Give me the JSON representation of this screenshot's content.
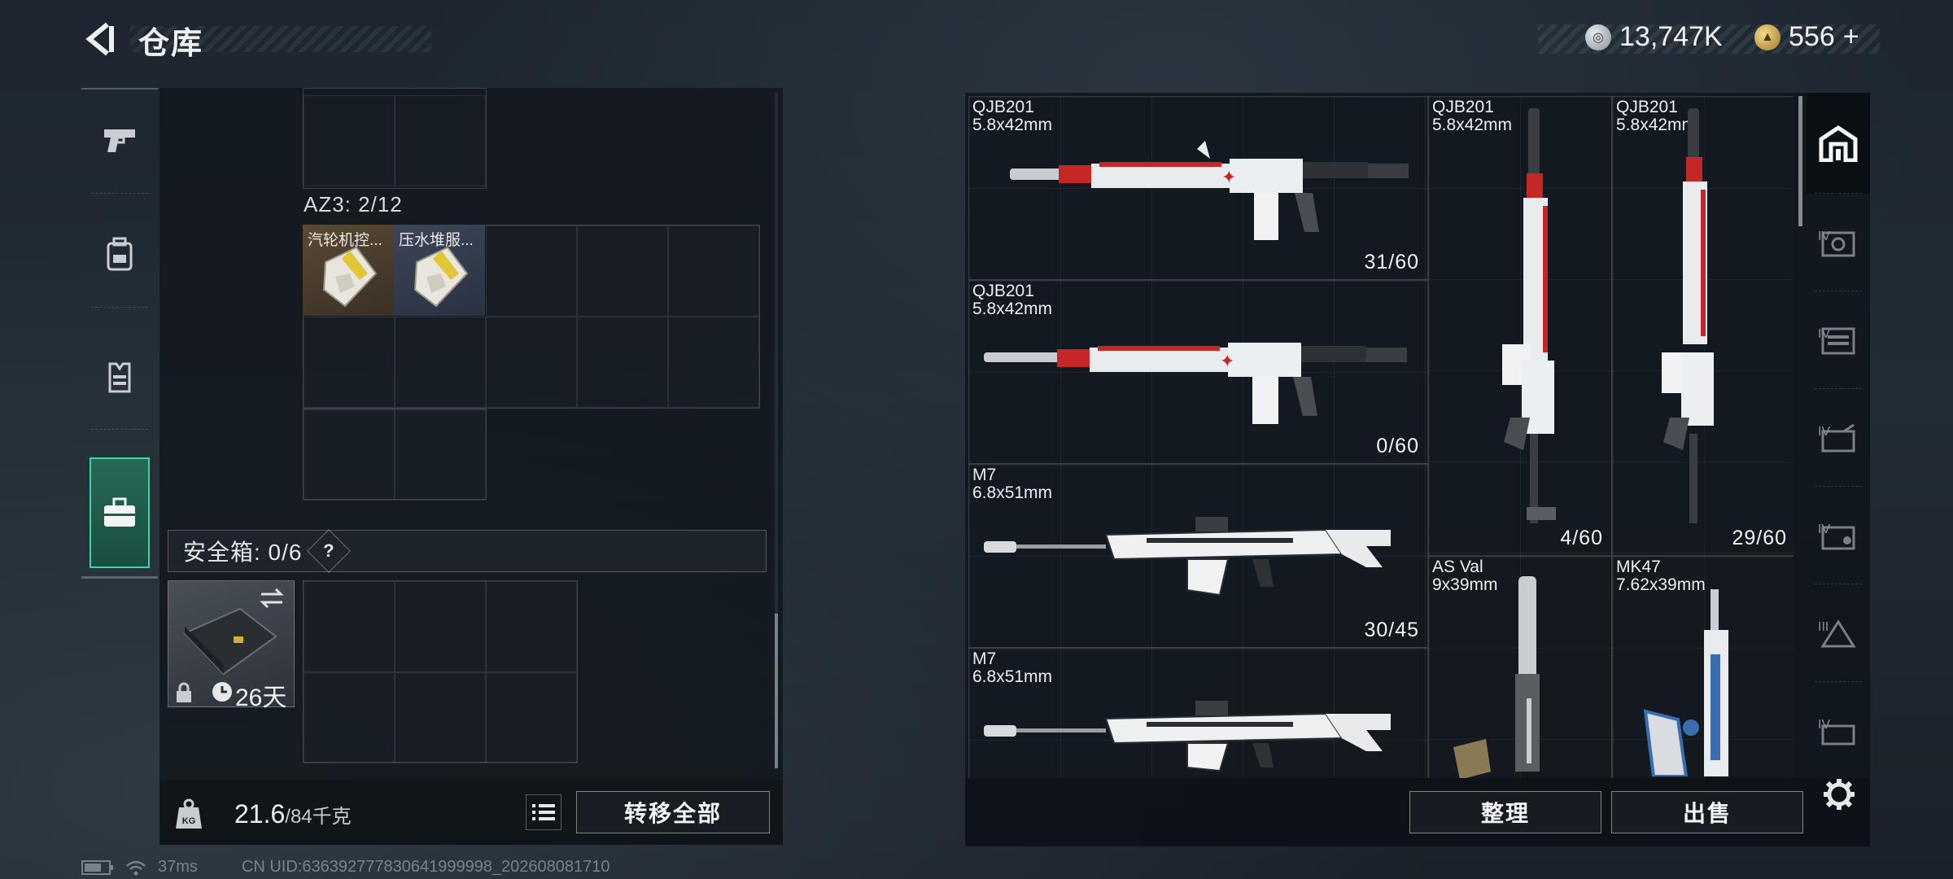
{
  "header": {
    "title": "仓库",
    "currency": [
      {
        "icon": "silver-coin-icon",
        "value": "13,747K"
      },
      {
        "icon": "gold-coin-icon",
        "value": "556"
      }
    ],
    "add_label": "+"
  },
  "left_rail": {
    "items": [
      {
        "icon": "pistol-icon",
        "active": false
      },
      {
        "icon": "backpack-icon",
        "active": false
      },
      {
        "icon": "vest-icon",
        "active": false
      },
      {
        "icon": "briefcase-icon",
        "active": true
      }
    ]
  },
  "inventory": {
    "az3_label": "AZ3: 2/12",
    "items": [
      {
        "name": "汽轮机控...",
        "icon": "supply-pack-icon"
      },
      {
        "name": "压水堆服...",
        "icon": "supply-pack-icon"
      }
    ],
    "safe_box": {
      "label": "安全箱: 0/6",
      "help": "?",
      "days": "26天",
      "swap_icon": "swap-arrows-icon",
      "lock_icon": "lock-icon",
      "clock_icon": "clock-icon"
    }
  },
  "left_footer": {
    "kg_label": "KG",
    "weight_current": "21.6",
    "weight_max": "/84千克",
    "transfer_all": "转移全部"
  },
  "weapons": [
    {
      "name": "QJB201",
      "caliber": "5.8x42mm",
      "ammo": "31/60"
    },
    {
      "name": "QJB201",
      "caliber": "5.8x42mm",
      "ammo": "0/60"
    },
    {
      "name": "M7",
      "caliber": "6.8x51mm",
      "ammo": "30/45"
    },
    {
      "name": "M7",
      "caliber": "6.8x51mm",
      "ammo": ""
    },
    {
      "name": "QJB201",
      "caliber": "5.8x42mm",
      "ammo": "4/60"
    },
    {
      "name": "QJB201",
      "caliber": "5.8x42mm",
      "ammo": "29/60"
    },
    {
      "name": "AS Val",
      "caliber": "9x39mm",
      "ammo": ""
    },
    {
      "name": "MK47",
      "caliber": "7.62x39mm",
      "ammo": ""
    }
  ],
  "right_footer": {
    "sort": "整理",
    "sell": "出售"
  },
  "side_rail": {
    "items": [
      {
        "icon": "warehouse-icon",
        "level": "",
        "active": true
      },
      {
        "icon": "storage-crate-icon",
        "level": "IV",
        "active": false
      },
      {
        "icon": "cabinet-icon",
        "level": "IV",
        "active": false
      },
      {
        "icon": "ammo-box-icon",
        "level": "IV",
        "active": false
      },
      {
        "icon": "case-icon",
        "level": "IV",
        "active": false
      },
      {
        "icon": "supply-box-icon",
        "level": "III",
        "active": false
      },
      {
        "icon": "container-icon",
        "level": "IV",
        "active": false
      }
    ]
  },
  "status": {
    "ping": "37ms",
    "uid": "CN UID:636392777830641999998_202608081710"
  },
  "colors": {
    "accent": "#3fd3a8",
    "weapon_red": "#d22828",
    "weapon_white": "#e9ecef"
  }
}
